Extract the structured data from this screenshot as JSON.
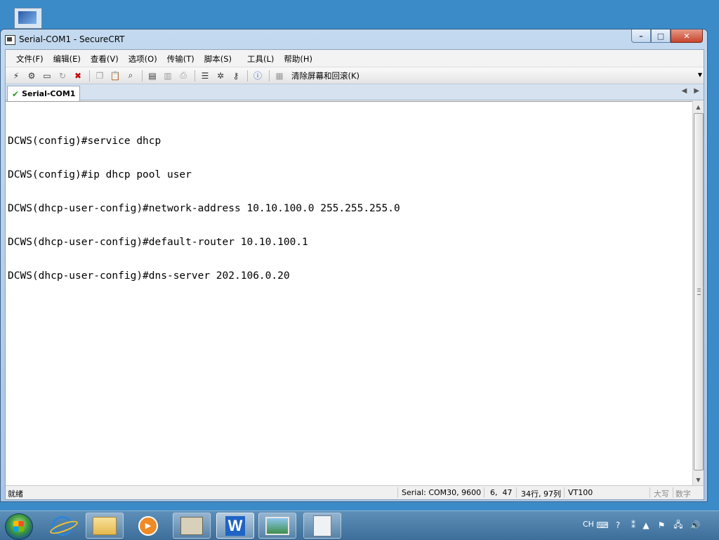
{
  "window": {
    "title": "Serial-COM1 - SecureCRT",
    "controls": {
      "minimize": "–",
      "maximize": "□",
      "close": "✕"
    }
  },
  "menubar": [
    "文件(F)",
    "编辑(E)",
    "查看(V)",
    "选项(O)",
    "传输(T)",
    "脚本(S)",
    "工具(L)",
    "帮助(H)"
  ],
  "toolbar": {
    "clear_screen_label": "清除屏幕和回滚(K)"
  },
  "tab": {
    "label": "Serial-COM1",
    "nav_prev": "◀",
    "nav_next": "▶"
  },
  "terminal": {
    "lines": [
      "DCWS(config)#service dhcp",
      "DCWS(config)#ip dhcp pool user",
      "DCWS(dhcp-user-config)#network-address 10.10.100.0 255.255.255.0",
      "DCWS(dhcp-user-config)#default-router 10.10.100.1",
      "DCWS(dhcp-user-config)#dns-server 202.106.0.20"
    ]
  },
  "statusbar": {
    "ready": "就绪",
    "connection": "Serial: COM30, 9600",
    "cursor": "6,  47",
    "size": "34行, 97列",
    "emulation": "VT100",
    "caps": "大写",
    "num": "数字"
  },
  "tray": {
    "lang": "CH"
  },
  "colors": {
    "desktop": "#3b8bc8",
    "window_frame": "#c3d9ef",
    "terminal_bg": "#ffffff",
    "terminal_fg": "#000000"
  }
}
